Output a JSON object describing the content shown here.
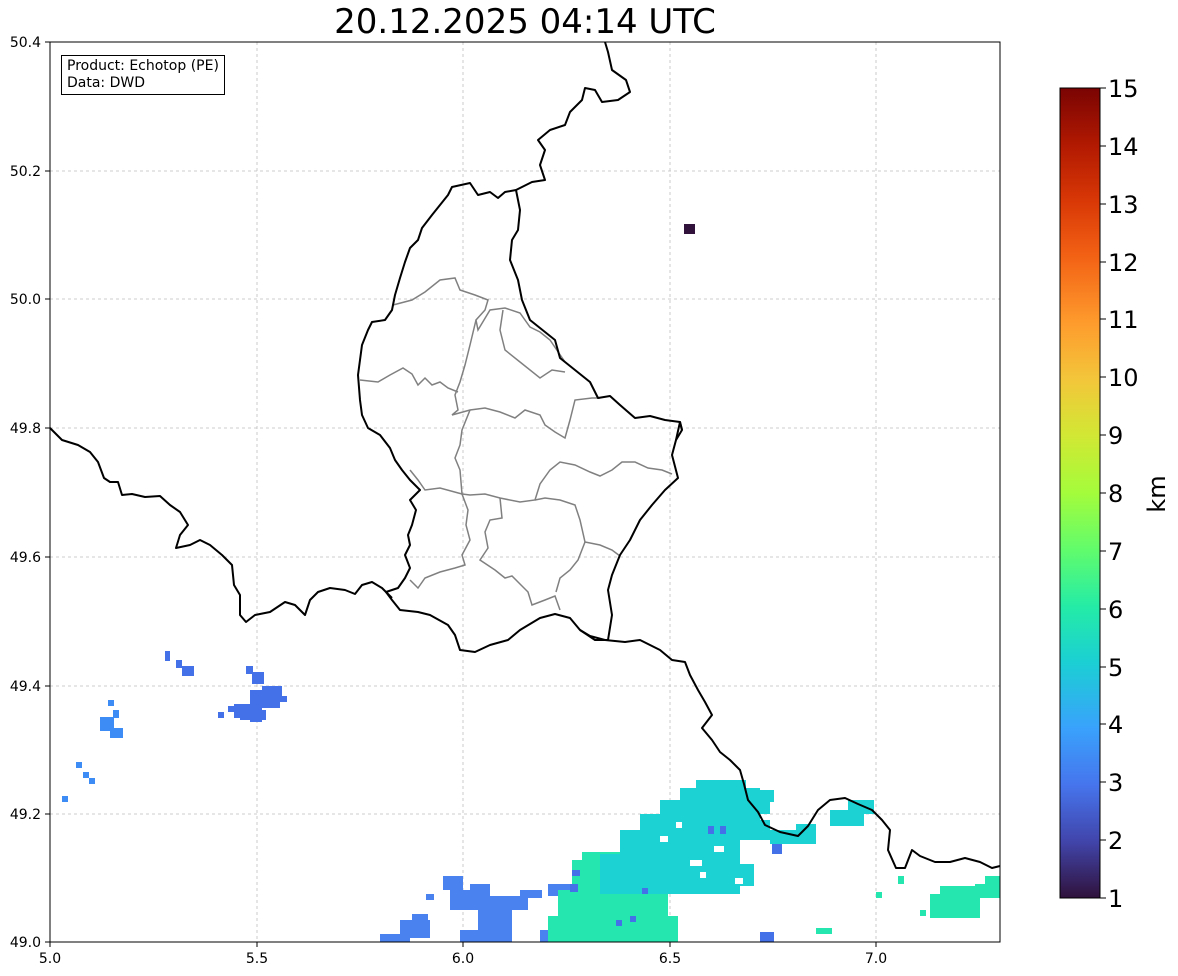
{
  "title": "20.12.2025 04:14 UTC",
  "info_box": {
    "product": "Product: Echotop (PE)",
    "data": "Data: DWD"
  },
  "map": {
    "lon_range": [
      5.0,
      7.3
    ],
    "lat_range": [
      49.0,
      50.4
    ],
    "x_ticks": [
      "5.0",
      "5.5",
      "6.0",
      "6.5",
      "7.0"
    ],
    "y_ticks": [
      "49.0",
      "49.2",
      "49.4",
      "49.6",
      "49.8",
      "50.0",
      "50.2",
      "50.4"
    ],
    "grid": true
  },
  "colorbar": {
    "label": "km",
    "range": [
      1,
      15
    ],
    "ticks": [
      "1",
      "2",
      "3",
      "4",
      "5",
      "6",
      "7",
      "8",
      "9",
      "10",
      "11",
      "12",
      "13",
      "14",
      "15"
    ],
    "colors": [
      "#30123b",
      "#4145ab",
      "#4675ed",
      "#39a2fc",
      "#1bcfd4",
      "#24eca6",
      "#61fc6c",
      "#a4fc3b",
      "#d1e834",
      "#f3c63a",
      "#fe9b2d",
      "#f36315",
      "#d93806",
      "#b11901",
      "#7a0403"
    ]
  }
}
